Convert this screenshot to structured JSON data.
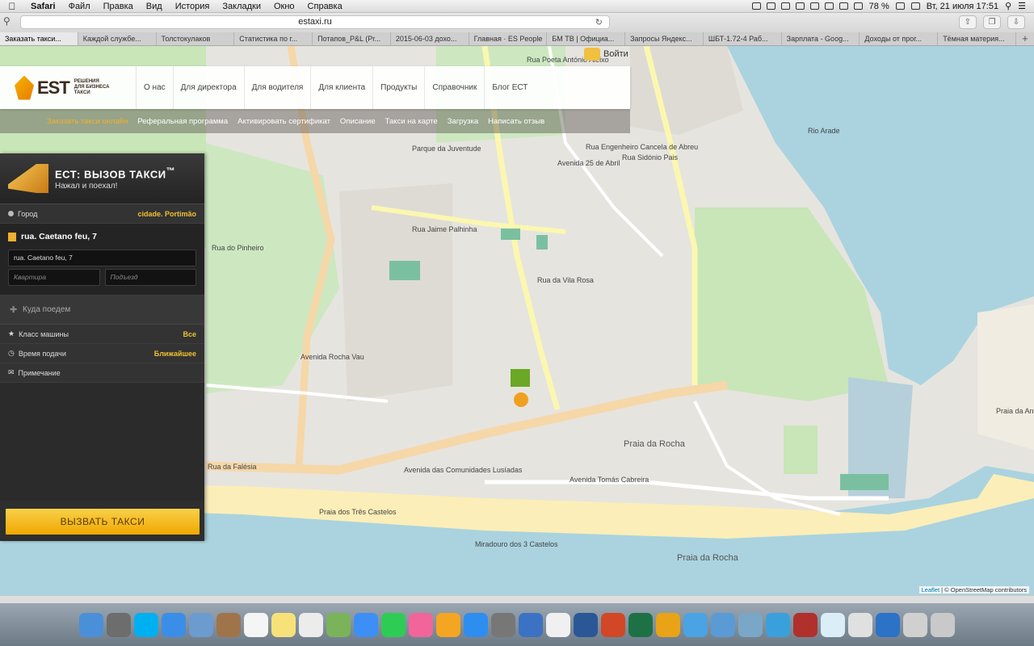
{
  "menubar": {
    "app": "Safari",
    "items": [
      "Файл",
      "Правка",
      "Вид",
      "История",
      "Закладки",
      "Окно",
      "Справка"
    ],
    "battery": "78 %",
    "datetime": "Вт, 21 июля  17:51"
  },
  "toolbar": {
    "url": "estaxi.ru"
  },
  "tabs": [
    "Заказать такси...",
    "Каждой службе...",
    "Толстокулаков",
    "Статистика по г...",
    "Потапов_P&L (Pr...",
    "2015-06-03 дохо...",
    "Главная · ES People",
    "БМ ТВ | Официа...",
    "Запросы Яндекс...",
    "ШБТ-1.72-4 Раб...",
    "Зарплата - Goog...",
    "Доходы от прог...",
    "Тёмная материя..."
  ],
  "site": {
    "login": "Войти",
    "logo": "EST",
    "logo_sub": "РЕШЕНИЯ ДЛЯ БИЗНЕСА ТАКСИ",
    "nav": [
      "О нас",
      "Для директора",
      "Для водителя",
      "Для клиента",
      "Продукты",
      "Справочник",
      "Блог ЕСТ"
    ],
    "subnav": [
      "Заказать такси онлайн",
      "Реферальная программа",
      "Активировать сертификат",
      "Описание",
      "Такси на карте",
      "Загрузка",
      "Написать отзыв"
    ]
  },
  "panel": {
    "title": "ЕСТ: ВЫЗОВ ТАКСИ",
    "tm": "™",
    "subtitle": "Нажал и поехал!",
    "city_label": "Город",
    "city_value": "cidade. Portimão",
    "address_title": "rua. Caetano feu, 7",
    "address_value": "rua. Caetano feu, 7",
    "apartment_ph": "Квартира",
    "entrance_ph": "Подъезд",
    "dest_label": "Куда поедем",
    "class_label": "Класс машины",
    "class_value": "Все",
    "time_label": "Время подачи",
    "time_value": "Ближайшее",
    "note_label": "Примечание",
    "call_button": "ВЫЗВАТЬ ТАКСИ"
  },
  "map": {
    "attribution_leaflet": "Leaflet",
    "attribution_rest": " | © OpenStreetMap contributors",
    "labels": [
      {
        "t": "Rua Poeta António Aleixo"
      },
      {
        "t": "Parque da Juventude"
      },
      {
        "t": "Rua Jaime Palhinha"
      },
      {
        "t": "Avenida 25 de Abril"
      },
      {
        "t": "Rua Engenheiro Cancela de Abreu"
      },
      {
        "t": "Rua Sidónio Pais"
      },
      {
        "t": "Rua da Vila Rosa"
      },
      {
        "t": "Avenida das Comunidades Lusíadas"
      },
      {
        "t": "Praia da Rocha"
      },
      {
        "t": "Avenida Tomás Cabreira"
      },
      {
        "t": "Praia dos Três Castelos"
      },
      {
        "t": "Miradouro dos 3 Castelos"
      },
      {
        "t": "Praia da Rocha"
      },
      {
        "t": "Praia da Angrinha"
      },
      {
        "t": "Rua do Pinheiro"
      },
      {
        "t": "Avenida Rocha Vau"
      },
      {
        "t": "Rio Arade"
      },
      {
        "t": "Rua da Falésia"
      }
    ]
  }
}
